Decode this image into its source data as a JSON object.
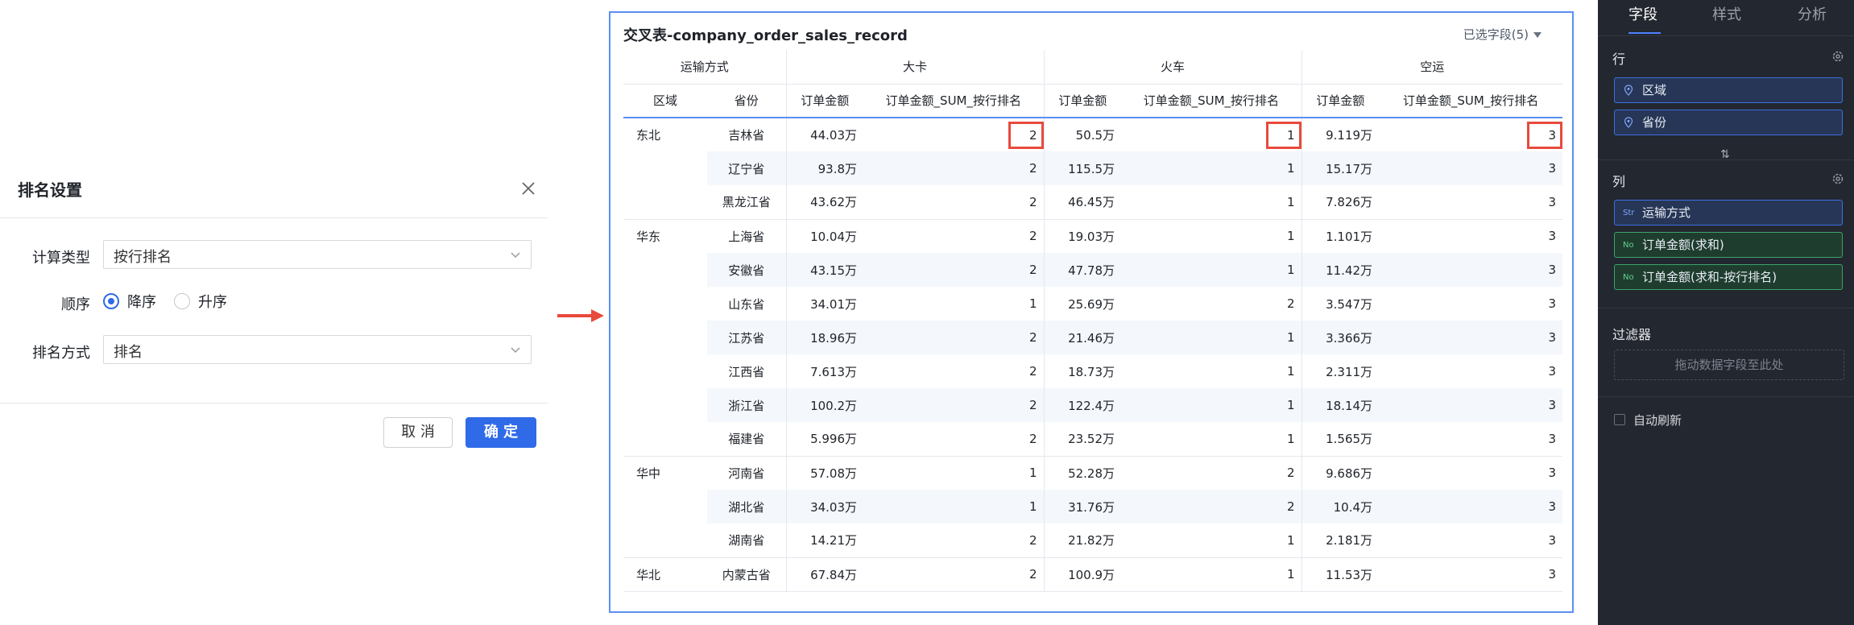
{
  "dialog": {
    "title": "排名设置",
    "calc_type_label": "计算类型",
    "calc_type_value": "按行排名",
    "order_label": "顺序",
    "order_options": [
      "降序",
      "升序"
    ],
    "order_selected": "降序",
    "rank_method_label": "排名方式",
    "rank_method_value": "排名",
    "cancel_label": "取 消",
    "ok_label": "确 定"
  },
  "table": {
    "title": "交叉表-company_order_sales_record",
    "selected_fields": "已选字段(5)",
    "col_dim_label": "运输方式",
    "row_headers": [
      "区域",
      "省份"
    ],
    "transports": [
      "大卡",
      "火车",
      "空运"
    ],
    "measure_headers": [
      "订单金额",
      "订单金额_SUM_按行排名"
    ],
    "rows": [
      {
        "region": "东北",
        "province": "吉林省",
        "v": [
          "44.03万",
          "2",
          "50.5万",
          "1",
          "9.119万",
          "3"
        ]
      },
      {
        "region": "",
        "province": "辽宁省",
        "v": [
          "93.8万",
          "2",
          "115.5万",
          "1",
          "15.17万",
          "3"
        ]
      },
      {
        "region": "",
        "province": "黑龙江省",
        "v": [
          "43.62万",
          "2",
          "46.45万",
          "1",
          "7.826万",
          "3"
        ]
      },
      {
        "region": "华东",
        "province": "上海省",
        "v": [
          "10.04万",
          "2",
          "19.03万",
          "1",
          "1.101万",
          "3"
        ]
      },
      {
        "region": "",
        "province": "安徽省",
        "v": [
          "43.15万",
          "2",
          "47.78万",
          "1",
          "11.42万",
          "3"
        ]
      },
      {
        "region": "",
        "province": "山东省",
        "v": [
          "34.01万",
          "1",
          "25.69万",
          "2",
          "3.547万",
          "3"
        ]
      },
      {
        "region": "",
        "province": "江苏省",
        "v": [
          "18.96万",
          "2",
          "21.46万",
          "1",
          "3.366万",
          "3"
        ]
      },
      {
        "region": "",
        "province": "江西省",
        "v": [
          "7.613万",
          "2",
          "18.73万",
          "1",
          "2.311万",
          "3"
        ]
      },
      {
        "region": "",
        "province": "浙江省",
        "v": [
          "100.2万",
          "2",
          "122.4万",
          "1",
          "18.14万",
          "3"
        ]
      },
      {
        "region": "",
        "province": "福建省",
        "v": [
          "5.996万",
          "2",
          "23.52万",
          "1",
          "1.565万",
          "3"
        ]
      },
      {
        "region": "华中",
        "province": "河南省",
        "v": [
          "57.08万",
          "1",
          "52.28万",
          "2",
          "9.686万",
          "3"
        ]
      },
      {
        "region": "",
        "province": "湖北省",
        "v": [
          "34.03万",
          "1",
          "31.76万",
          "2",
          "10.4万",
          "3"
        ]
      },
      {
        "region": "",
        "province": "湖南省",
        "v": [
          "14.21万",
          "2",
          "21.82万",
          "1",
          "2.181万",
          "3"
        ]
      },
      {
        "region": "华北",
        "province": "内蒙古省",
        "v": [
          "67.84万",
          "2",
          "100.9万",
          "1",
          "11.53万",
          "3"
        ]
      }
    ]
  },
  "panel": {
    "tabs": [
      "字段",
      "样式",
      "分析"
    ],
    "rows_label": "行",
    "row_fields": [
      "区域",
      "省份"
    ],
    "cols_label": "列",
    "col_fields": [
      {
        "tag": "Str",
        "name": "运输方式"
      },
      {
        "tag": "No",
        "name": "订单金额(求和)"
      },
      {
        "tag": "No",
        "name": "订单金额(求和-按行排名)"
      }
    ],
    "filter_label": "过滤器",
    "filter_placeholder": "拖动数据字段至此处",
    "auto_refresh_label": "自动刷新"
  },
  "colors": {
    "accent": "#2f6be8",
    "highlight_box": "#e84a3c",
    "panel_bg": "#23272f",
    "dimension_pill": "#273656",
    "measure_pill": "#1f3d2e"
  }
}
